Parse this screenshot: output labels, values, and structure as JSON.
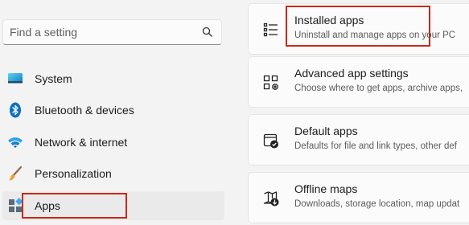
{
  "search": {
    "placeholder": "Find a setting",
    "icon": "search-icon"
  },
  "sidebar": {
    "items": [
      {
        "label": "System",
        "icon": "system-monitor-icon"
      },
      {
        "label": "Bluetooth & devices",
        "icon": "bluetooth-icon"
      },
      {
        "label": "Network & internet",
        "icon": "wifi-icon"
      },
      {
        "label": "Personalization",
        "icon": "brush-icon"
      },
      {
        "label": "Apps",
        "icon": "apps-icon",
        "selected": true
      }
    ]
  },
  "main": {
    "cards": [
      {
        "title": "Installed apps",
        "subtitle": "Uninstall and manage apps on your PC",
        "icon": "list-icon"
      },
      {
        "title": "Advanced app settings",
        "subtitle": "Choose where to get apps, archive apps,",
        "icon": "app-settings-icon"
      },
      {
        "title": "Default apps",
        "subtitle": "Defaults for file and link types, other def",
        "icon": "default-apps-icon"
      },
      {
        "title": "Offline maps",
        "subtitle": "Downloads, storage location, map updat",
        "icon": "map-download-icon"
      }
    ]
  },
  "colors": {
    "accent": "#0067c0",
    "highlight": "#c42b1c"
  }
}
